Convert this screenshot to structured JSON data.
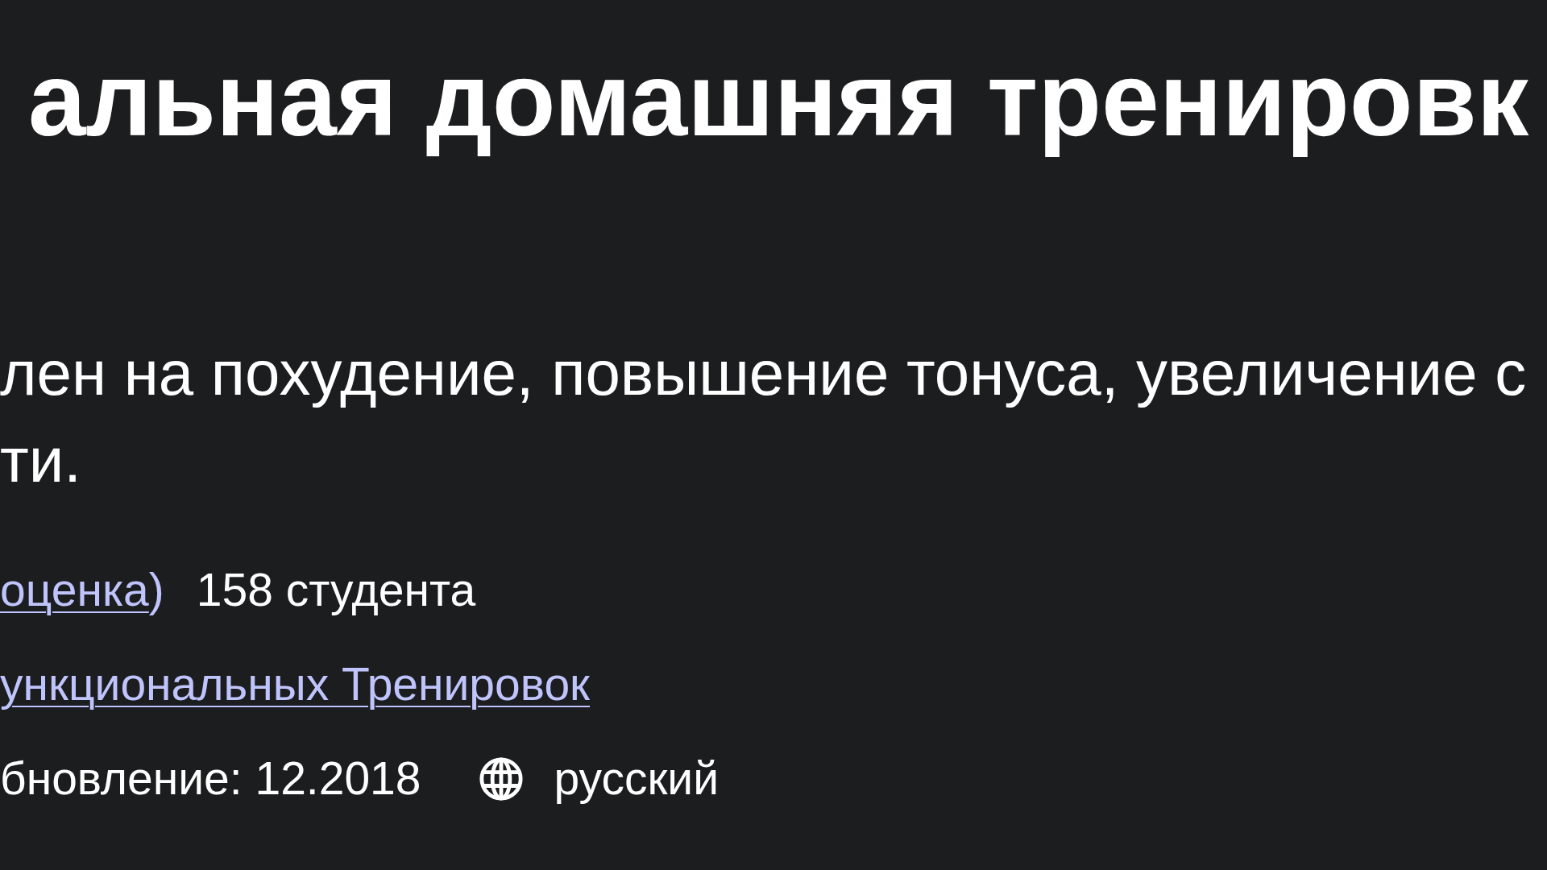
{
  "course_header": {
    "title": "альная домашняя тренировк",
    "description_lines": [
      "лен на похудение, повышение тонуса, увеличение с",
      "ти."
    ],
    "rating": {
      "link": "оценка",
      "closing": ")"
    },
    "students": "158 студента",
    "instructor_link": "ункциональных Тренировок",
    "last_updated": "бновление: 12.2018",
    "language": "русский"
  }
}
